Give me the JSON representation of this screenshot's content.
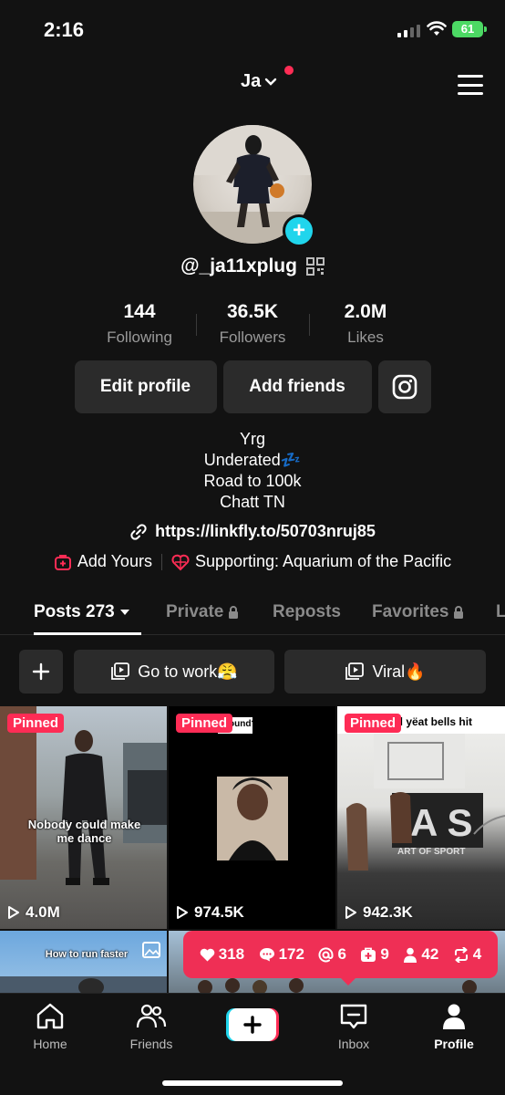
{
  "status_bar": {
    "time": "2:16",
    "battery": "61"
  },
  "header": {
    "account_name": "Ja",
    "menu_icon": "hamburger-menu-icon"
  },
  "profile": {
    "username": "@_ja11xplug",
    "stats": [
      {
        "value": "144",
        "label": "Following"
      },
      {
        "value": "36.5K",
        "label": "Followers"
      },
      {
        "value": "2.0M",
        "label": "Likes"
      }
    ],
    "buttons": {
      "edit": "Edit profile",
      "add_friends": "Add friends"
    },
    "bio_lines": [
      "Yrg",
      "Underated💤",
      "Road to 100k",
      "Chatt TN"
    ],
    "link": "https://linkfly.to/50703nruj85",
    "chips": {
      "add_yours": "Add Yours",
      "supporting": "Supporting: Aquarium of the Pacific"
    }
  },
  "tabs": [
    "Posts 273",
    "Private",
    "Reposts",
    "Favorites",
    "L"
  ],
  "playlists": [
    "Go to work😤",
    "Viral🔥"
  ],
  "videos": [
    {
      "pinned": "Pinned",
      "views": "4.0M",
      "caption": "Nobody could make me dance"
    },
    {
      "pinned": "Pinned",
      "views": "974.5K",
      "caption": "ound?"
    },
    {
      "pinned": "Pinned",
      "views": "942.3K",
      "caption": "rd yëat bells hit"
    },
    {
      "caption": "How to run faster"
    }
  ],
  "engagement": {
    "likes": "318",
    "comments": "172",
    "mentions": "6",
    "add_yours": "9",
    "followers": "42",
    "reposts": "4"
  },
  "bottom_nav": {
    "home": "Home",
    "friends": "Friends",
    "inbox": "Inbox",
    "profile": "Profile"
  },
  "colors": {
    "accent": "#fe2c55",
    "cyan": "#20d5ec",
    "background": "#121212"
  }
}
